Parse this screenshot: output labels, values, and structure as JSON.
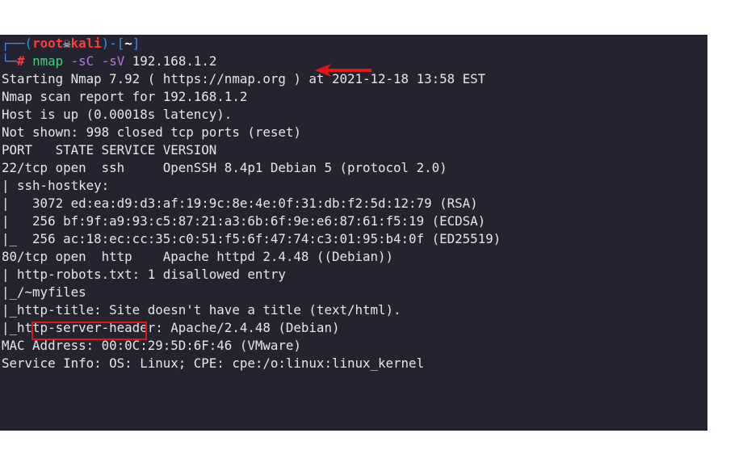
{
  "prompt": {
    "corner_top": "┌──",
    "open_paren": "(",
    "user": "root",
    "skull_glyph": "☠",
    "host": "kali",
    "close_paren": ")-[",
    "path": "~",
    "close_bracket": "]",
    "corner_bottom": "└─",
    "hash": "#",
    "cmd": "nmap",
    "flag1": "-sC",
    "flag2": "-sV",
    "target": "192.168.1.2"
  },
  "output_lines": [
    "Starting Nmap 7.92 ( https://nmap.org ) at 2021-12-18 13:58 EST",
    "Nmap scan report for 192.168.1.2",
    "Host is up (0.00018s latency).",
    "Not shown: 998 closed tcp ports (reset)",
    "PORT   STATE SERVICE VERSION",
    "22/tcp open  ssh     OpenSSH 8.4p1 Debian 5 (protocol 2.0)",
    "| ssh-hostkey:",
    "|   3072 ed:ea:d9:d3:af:19:9c:8e:4e:0f:31:db:f2:5d:12:79 (RSA)",
    "|   256 bf:9f:a9:93:c5:87:21:a3:6b:6f:9e:e6:87:61:f5:19 (ECDSA)",
    "|_  256 ac:18:ec:cc:35:c0:51:f5:6f:47:74:c3:01:95:b4:0f (ED25519)",
    "80/tcp open  http    Apache httpd 2.4.48 ((Debian))",
    "| http-robots.txt: 1 disallowed entry",
    "|_/~myfiles",
    "|_http-title: Site doesn't have a title (text/html).",
    "|_http-server-header: Apache/2.4.48 (Debian)",
    "MAC Address: 00:0C:29:5D:6F:46 (VMware)",
    "Service Info: OS: Linux; CPE: cpe:/o:linux:linux_kernel"
  ],
  "colors": {
    "terminal_bg": "#23242f",
    "prompt_blue": "#3b8eea",
    "prompt_red": "#ff3b3b",
    "cmd_green": "#3fd17a",
    "flag_purple": "#b877db",
    "annotation_red": "#e01717"
  },
  "icons": {
    "skull": "skull-icon",
    "arrow": "red-arrow-annotation"
  }
}
